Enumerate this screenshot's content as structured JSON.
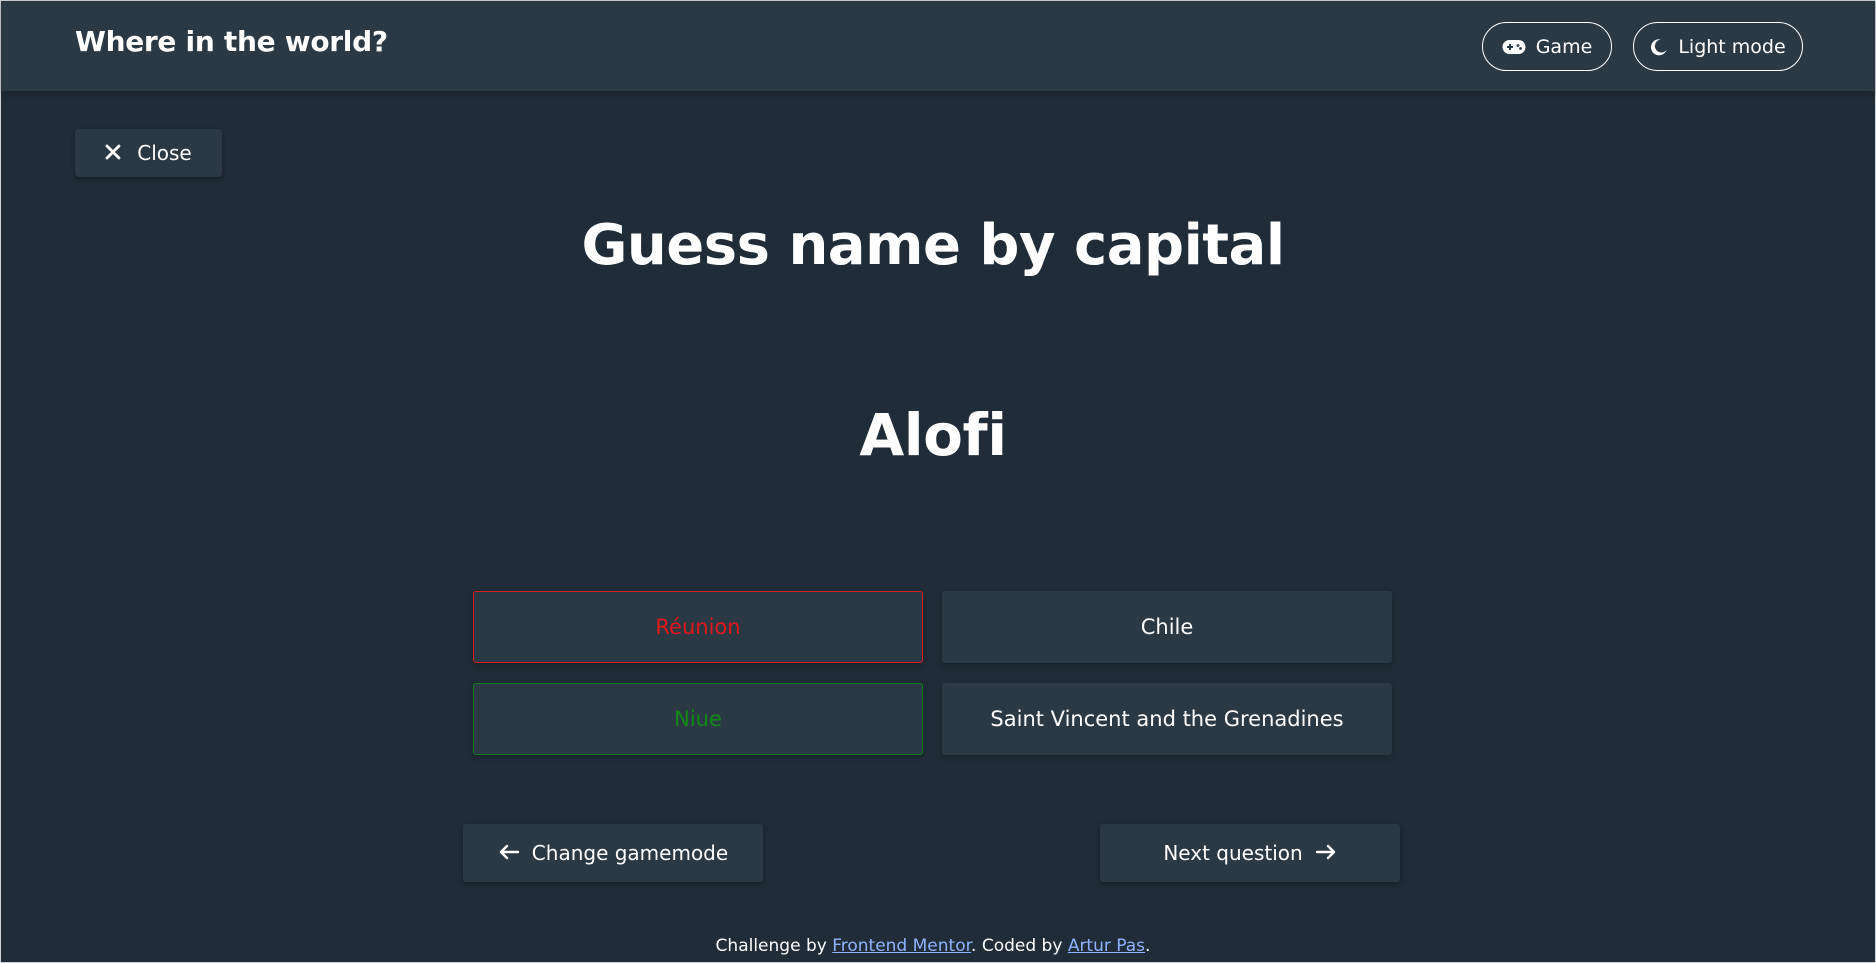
{
  "header": {
    "title": "Where in the world?",
    "game_label": "Game",
    "theme_label": "Light mode",
    "game_icon": "gamepad-icon",
    "theme_icon": "moon-icon"
  },
  "close": {
    "label": "Close",
    "icon": "close-icon"
  },
  "quiz": {
    "heading": "Guess name by capital",
    "capital": "Alofi",
    "answers": [
      {
        "label": "Réunion",
        "state": "wrong"
      },
      {
        "label": "Chile",
        "state": "neutral"
      },
      {
        "label": "Niue",
        "state": "correct"
      },
      {
        "label": "Saint Vincent and the Grenadines",
        "state": "neutral"
      }
    ]
  },
  "nav": {
    "back_label": "Change gamemode",
    "next_label": "Next question"
  },
  "footer": {
    "prefix": "Challenge by",
    "link1": "Frontend Mentor",
    "middle": ". Coded by",
    "link2": "Artur Pas",
    "suffix": "."
  },
  "colors": {
    "background": "#202c37",
    "elements": "#2b3945",
    "wrong": "#e1171c",
    "correct": "#108a14",
    "link": "#8fb3ff"
  }
}
